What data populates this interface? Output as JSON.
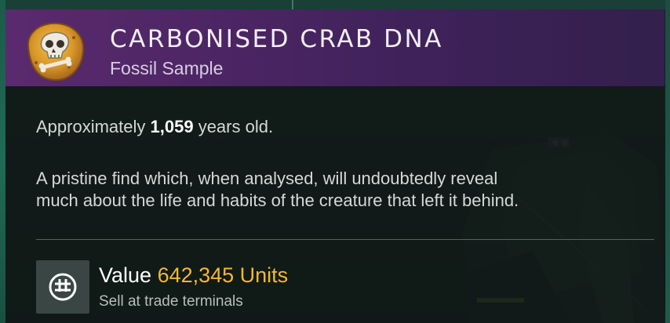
{
  "item": {
    "title": "CARBONISED CRAB DNA",
    "subtitle": "Fossil Sample",
    "icon": "fossil-skull-icon"
  },
  "details": {
    "age_prefix": "Approximately ",
    "age_value": "1,059",
    "age_suffix": " years old.",
    "description_line_1": "A pristine find which, when analysed, will undoubtedly reveal",
    "description_line_2": "much about the life and habits of the creature that left it behind."
  },
  "value": {
    "label": "Value ",
    "amount": "642,345 Units",
    "subtext": "Sell at trade terminals",
    "icon": "units-currency-icon"
  },
  "colors": {
    "header_gradient_start": "#5a2a6e",
    "header_gradient_end": "#33204c",
    "value_amount": "#f5b82e",
    "body_text": "#d4d9d7"
  }
}
